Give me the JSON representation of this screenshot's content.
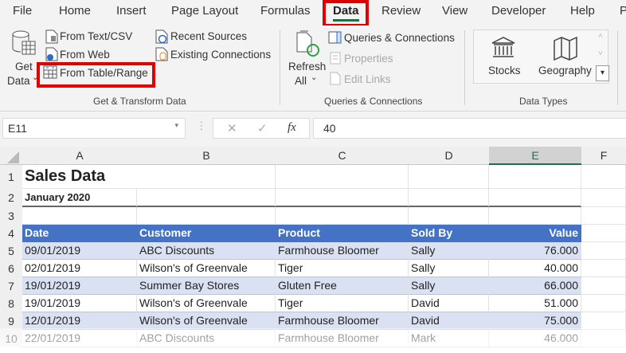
{
  "tabs": [
    "File",
    "Home",
    "Insert",
    "Page Layout",
    "Formulas",
    "Data",
    "Review",
    "View",
    "Developer",
    "Help",
    "P"
  ],
  "active_tab": "Data",
  "ribbon": {
    "get_data": [
      "Get",
      "Data"
    ],
    "from_text": "From Text/CSV",
    "from_web": "From Web",
    "from_table": "From Table/Range",
    "recent": "Recent Sources",
    "existing": "Existing Connections",
    "group1": "Get & Transform Data",
    "refresh": [
      "Refresh",
      "All"
    ],
    "queries": "Queries & Connections",
    "properties": "Properties",
    "edit_links": "Edit Links",
    "group2": "Queries & Connections",
    "stocks": "Stocks",
    "geography": "Geography",
    "group3": "Data Types"
  },
  "formula_bar": {
    "name_box": "E11",
    "cancel": "✕",
    "enter": "✓",
    "fx": "fx",
    "value": "40"
  },
  "columns": [
    "A",
    "B",
    "C",
    "D",
    "E",
    "F"
  ],
  "rows": [
    "1",
    "2",
    "3",
    "4",
    "5",
    "6",
    "7",
    "8",
    "9",
    "10"
  ],
  "title": "Sales Data",
  "subtitle": "January 2020",
  "table": {
    "headers": [
      "Date",
      "Customer",
      "Product",
      "Sold By",
      "Value"
    ],
    "rows": [
      [
        "09/01/2019",
        "ABC Discounts",
        "Farmhouse Bloomer",
        "Sally",
        "76.000"
      ],
      [
        "02/01/2019",
        "Wilson's of Greenvale",
        "Tiger",
        "Sally",
        "40.000"
      ],
      [
        "19/01/2019",
        "Summer Bay Stores",
        "Gluten Free",
        "Sally",
        "66.000"
      ],
      [
        "19/01/2019",
        "Wilson's of Greenvale",
        "Tiger",
        "David",
        "51.000"
      ],
      [
        "12/01/2019",
        "Wilson's of Greenvale",
        "Farmhouse Bloomer",
        "David",
        "75.000"
      ],
      [
        "22/01/2019",
        "ABC Discounts",
        "Farmhouse Bloomer",
        "Mark",
        "46.000"
      ]
    ]
  },
  "colors": {
    "accent": "#1e7145",
    "highlight": "#e00000",
    "table_header": "#4472c4",
    "band": "#d9e1f2"
  }
}
